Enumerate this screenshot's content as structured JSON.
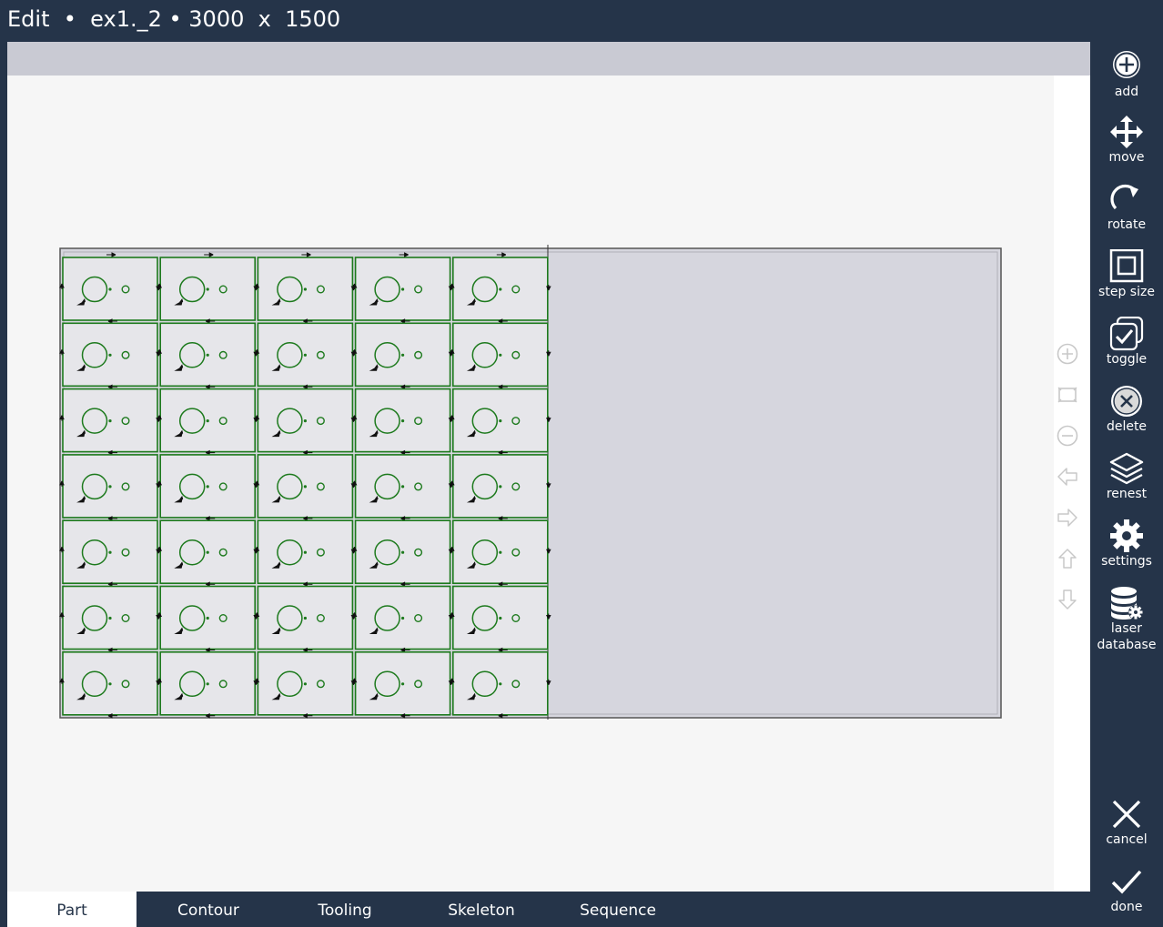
{
  "title": "Edit  •  ex1._2 • 3000  x  1500",
  "toolbar": {
    "add": "add",
    "move": "move",
    "rotate": "rotate",
    "step_size": "step size",
    "toggle": "toggle",
    "delete": "delete",
    "renest": "renest",
    "settings": "settings",
    "laser_database": "laser\ndatabase",
    "cancel": "cancel",
    "done": "done"
  },
  "tabs": {
    "part": "Part",
    "contour": "Contour",
    "tooling": "Tooling",
    "skeleton": "Skeleton",
    "sequence": "Sequence",
    "active": "Part"
  },
  "nest": {
    "sheet": "3000 x 1500",
    "rows": 7,
    "columns": 5
  },
  "colors": {
    "chrome": "#253449",
    "part_contour": "#1d7a1d",
    "sheet": "#d6d6de",
    "canvas": "#f6f6f6"
  },
  "icons": {
    "zoom_in": "zoom-in-icon",
    "zoom_fit": "zoom-fit-icon",
    "zoom_out": "zoom-out-icon",
    "pan_left": "arrow-left-icon",
    "pan_right": "arrow-right-icon",
    "pan_up": "arrow-up-icon",
    "pan_down": "arrow-down-icon"
  }
}
